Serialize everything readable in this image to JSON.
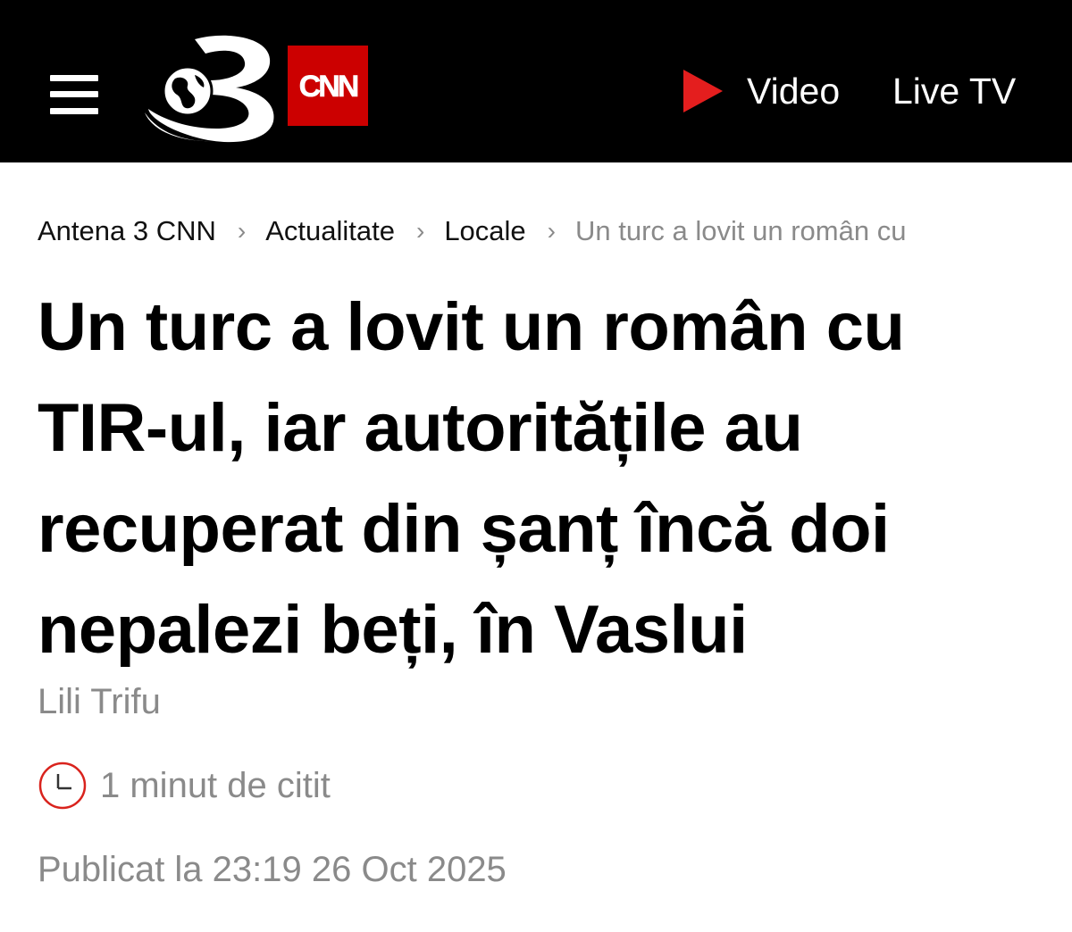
{
  "header": {
    "brand_3_logo_icon": "antena3-globe-3-logo",
    "brand_cnn_logo_text": "CNN",
    "menu_icon": "hamburger-icon",
    "nav": {
      "video_label": "Video",
      "video_icon": "play-triangle-icon",
      "live_label": "Live TV"
    },
    "colors": {
      "background": "#000000",
      "cnn_red": "#cc0000",
      "play_red": "#e41e1e"
    }
  },
  "breadcrumb": {
    "items": [
      {
        "label": "Antena 3 CNN"
      },
      {
        "label": "Actualitate"
      },
      {
        "label": "Locale"
      },
      {
        "label": "Un turc a lovit un român cu"
      }
    ],
    "separator": "›"
  },
  "article": {
    "title": "Un turc a lovit un român cu TIR-ul, iar autoritățile au recuperat din șanț încă doi nepalezi beți, în Vaslui",
    "author": "Lili Trifu",
    "read_time": "1 minut de citit",
    "read_time_icon": "clock-icon",
    "published": "Publicat la 23:19 26 Oct 2025",
    "colors": {
      "meta_gray": "#8a8a8a",
      "clock_red": "#d9231d"
    }
  }
}
